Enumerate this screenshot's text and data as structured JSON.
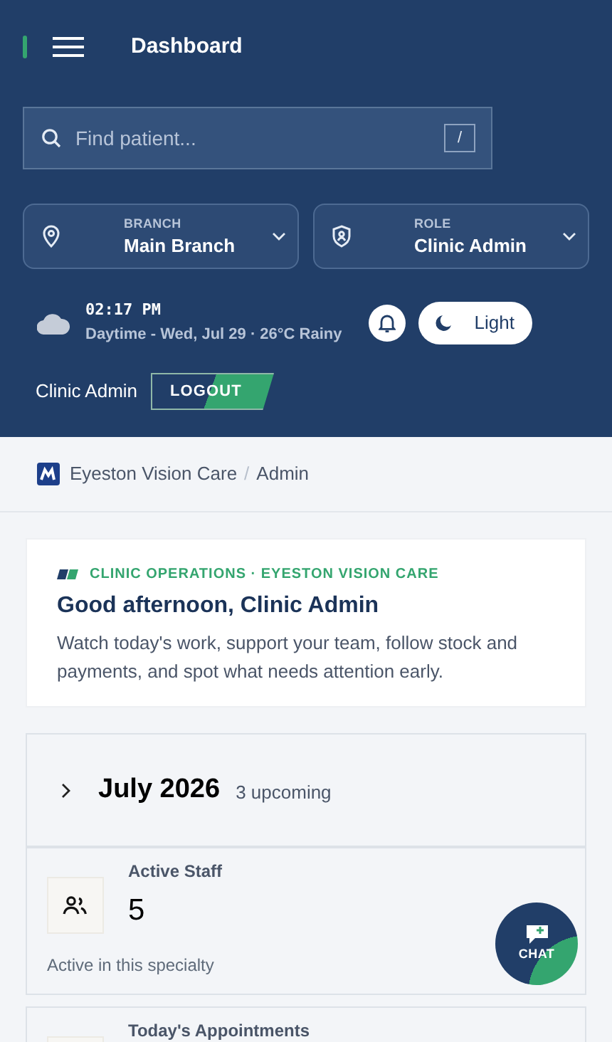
{
  "header": {
    "title": "Dashboard",
    "search": {
      "placeholder": "Find patient...",
      "shortcut": "/"
    },
    "selectors": [
      {
        "kind": "location",
        "label": "BRANCH",
        "value": "Main Branch"
      },
      {
        "kind": "shield",
        "label": "ROLE",
        "value": "Clinic Admin"
      }
    ],
    "clock": {
      "time": "02:17 PM",
      "details": "Daytime - Wed, Jul 29 · **26°C** Rainy"
    },
    "theme_button": "Light",
    "user": "Clinic Admin",
    "logout": "LOGOUT"
  },
  "breadcrumb": {
    "items": [
      "Eyeston Vision Care",
      "Admin"
    ],
    "separator": "/"
  },
  "greeting": {
    "eyebrow": "CLINIC OPERATIONS · EYESTON VISION CARE",
    "title": "Good afternoon, Clinic Admin",
    "body": "Watch today's work, support your team, follow stock and payments, and spot what needs attention early."
  },
  "calendar": {
    "month": "July 2026",
    "count": "3 upcoming",
    "expanded": false
  },
  "stats": [
    {
      "label": "Active Staff",
      "value": "5",
      "caption": "Active in this specialty"
    },
    {
      "label": "Today's Appointments"
    }
  ],
  "chat": "CHAT"
}
